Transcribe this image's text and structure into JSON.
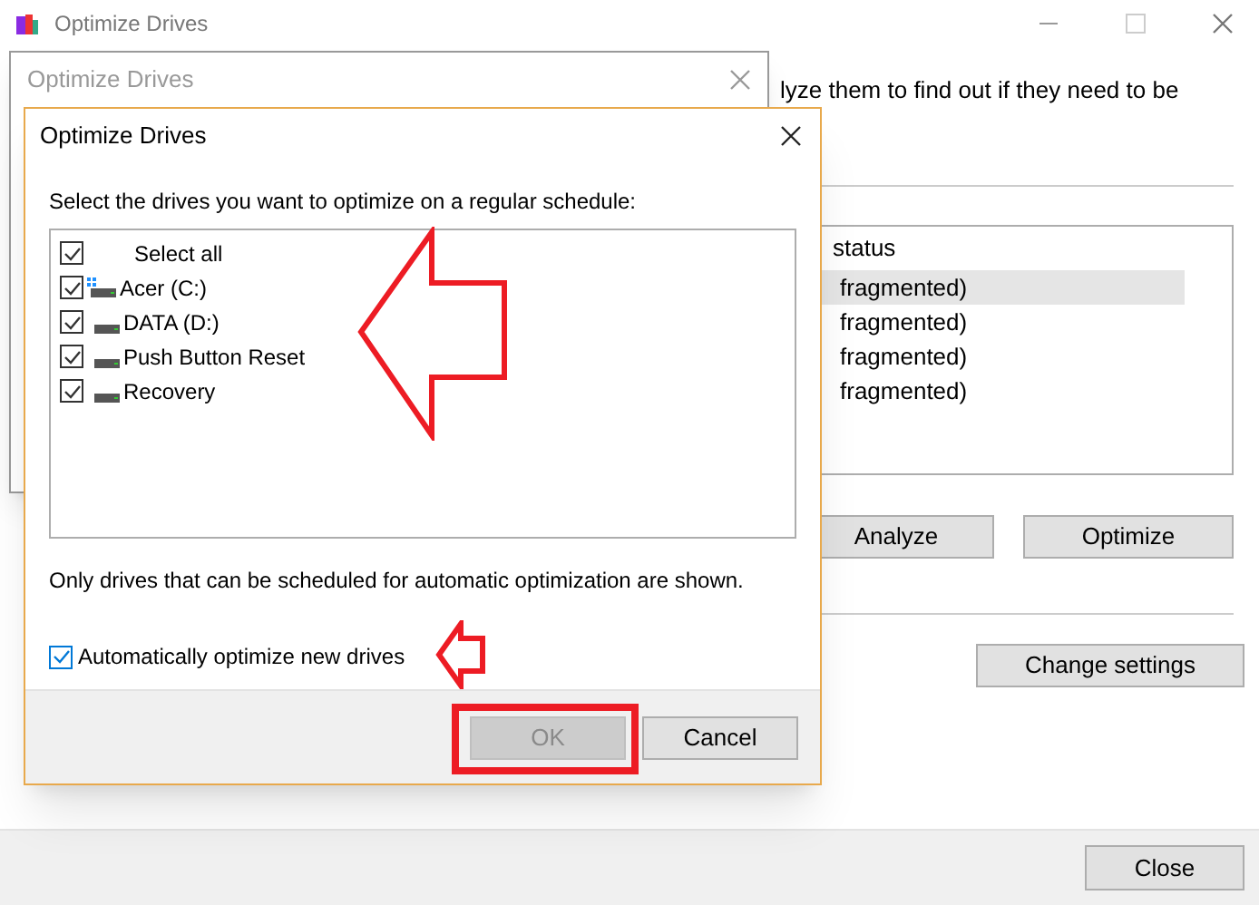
{
  "main_window": {
    "title": "Optimize Drives",
    "intro_text": "lyze them to find out if they need to be",
    "status_header": "status",
    "status_rows": [
      {
        "text": "fragmented)",
        "selected": true
      },
      {
        "text": "fragmented)",
        "selected": false
      },
      {
        "text": "fragmented)",
        "selected": false
      },
      {
        "text": "fragmented)",
        "selected": false
      }
    ],
    "action_buttons": [
      "Analyze",
      "Optimize"
    ],
    "settings_button": "Change settings",
    "close_button": "Close"
  },
  "back_dialog": {
    "title": "Optimize Drives"
  },
  "dialog": {
    "title": "Optimize Drives",
    "instruction": "Select the drives you want to optimize on a regular schedule:",
    "drives": [
      {
        "label": "Select all",
        "kind": "select_all",
        "checked": true
      },
      {
        "label": "Acer (C:)",
        "kind": "system_drive",
        "checked": true
      },
      {
        "label": "DATA (D:)",
        "kind": "drive",
        "checked": true
      },
      {
        "label": "Push Button Reset",
        "kind": "drive",
        "checked": true
      },
      {
        "label": "Recovery",
        "kind": "drive",
        "checked": true
      }
    ],
    "note": "Only drives that can be scheduled for automatic optimization are shown.",
    "auto_optimize": {
      "label": "Automatically optimize new drives",
      "checked": true
    },
    "buttons": [
      {
        "label": "OK",
        "disabled": true
      },
      {
        "label": "Cancel",
        "disabled": false
      }
    ]
  }
}
